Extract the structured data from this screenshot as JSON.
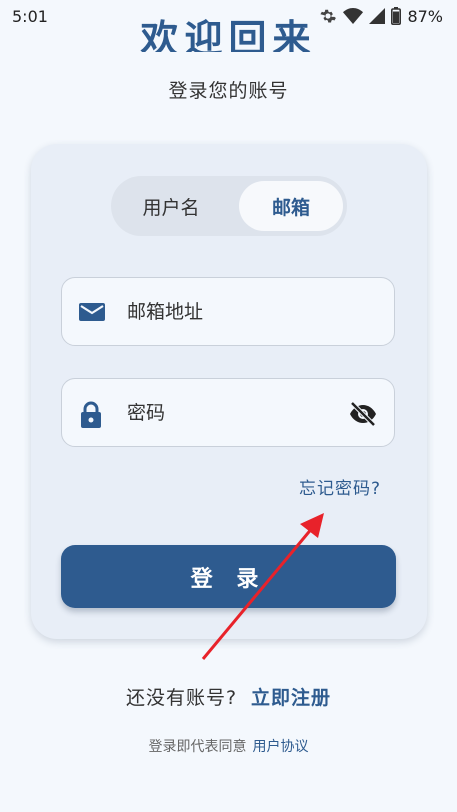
{
  "status_bar": {
    "time": "5:01",
    "battery": "87%",
    "icons": [
      "gear-icon",
      "wifi-icon",
      "signal-icon",
      "battery-icon"
    ]
  },
  "header": {
    "title": "欢迎回来",
    "subtitle": "登录您的账号"
  },
  "login_mode": {
    "tabs": [
      "用户名",
      "邮箱"
    ],
    "selected": "邮箱"
  },
  "form": {
    "email_placeholder": "邮箱地址",
    "password_placeholder": "密码",
    "forgot_label": "忘记密码?",
    "login_label": "登 录"
  },
  "footer": {
    "no_account": "还没有账号?",
    "register_label": "立即注册",
    "agree_text": "登录即代表同意",
    "agreement_label": "用户协议"
  },
  "colors": {
    "accent": "#2e5b8f",
    "background": "#f4f8fd",
    "card": "#e8eef7",
    "annotation_arrow": "#e8222a"
  }
}
